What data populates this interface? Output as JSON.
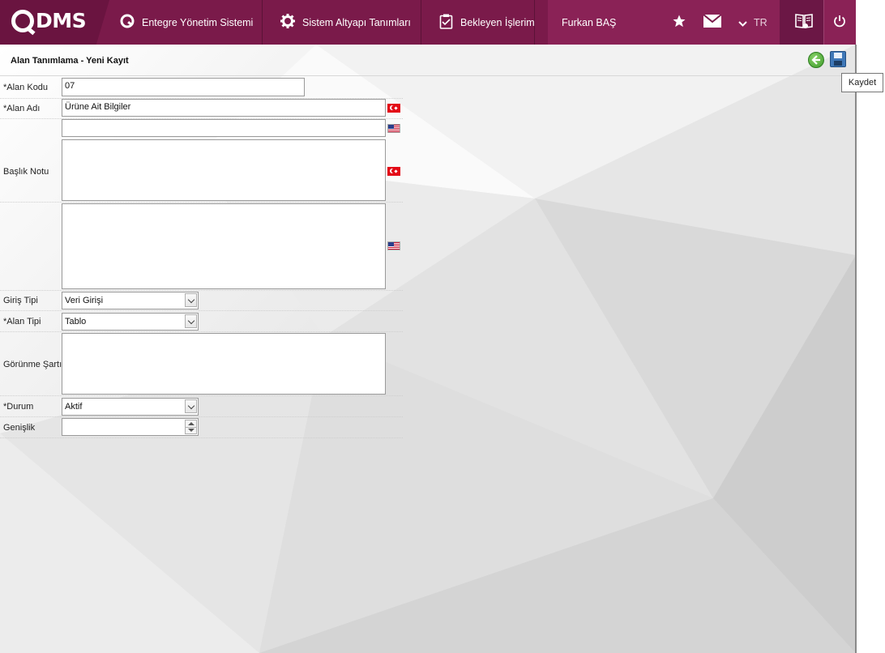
{
  "nav": {
    "logo": "DMS",
    "items": [
      {
        "label": "Entegre Yönetim Sistemi",
        "icon": "qdms-circle-icon"
      },
      {
        "label": "Sistem Altyapı Tanımları",
        "icon": "gear-icon"
      },
      {
        "label": "Bekleyen İşlerim",
        "icon": "clipboard-icon"
      }
    ],
    "user": "Furkan BAŞ",
    "language": "TR",
    "icons": [
      "star-icon",
      "mail-icon",
      "chevron-down-icon",
      "help-book-icon",
      "power-icon"
    ],
    "colors": {
      "bar": "#7a1a4a",
      "logo_bg": "#6a1440",
      "user_bg": "#8a2256"
    }
  },
  "page": {
    "title": "Alan Tanımlama - Yeni Kayıt",
    "tooltip": "Kaydet"
  },
  "form": {
    "alan_kodu": {
      "label": "*Alan Kodu",
      "value": "07"
    },
    "alan_adi": {
      "label": "*Alan Adı",
      "value_tr": "Ürüne Ait Bilgiler",
      "value_en": ""
    },
    "baslik_notu": {
      "label": "Başlık Notu"
    },
    "giris_tipi": {
      "label": "Giriş Tipi",
      "value": "Veri Girişi"
    },
    "alan_tipi": {
      "label": "*Alan Tipi",
      "value": "Tablo"
    },
    "gorunme_sarti": {
      "label": "Görünme Şartı"
    },
    "durum": {
      "label": "*Durum",
      "value": "Aktif"
    },
    "genislik": {
      "label": "Genişlik",
      "value": ""
    }
  }
}
